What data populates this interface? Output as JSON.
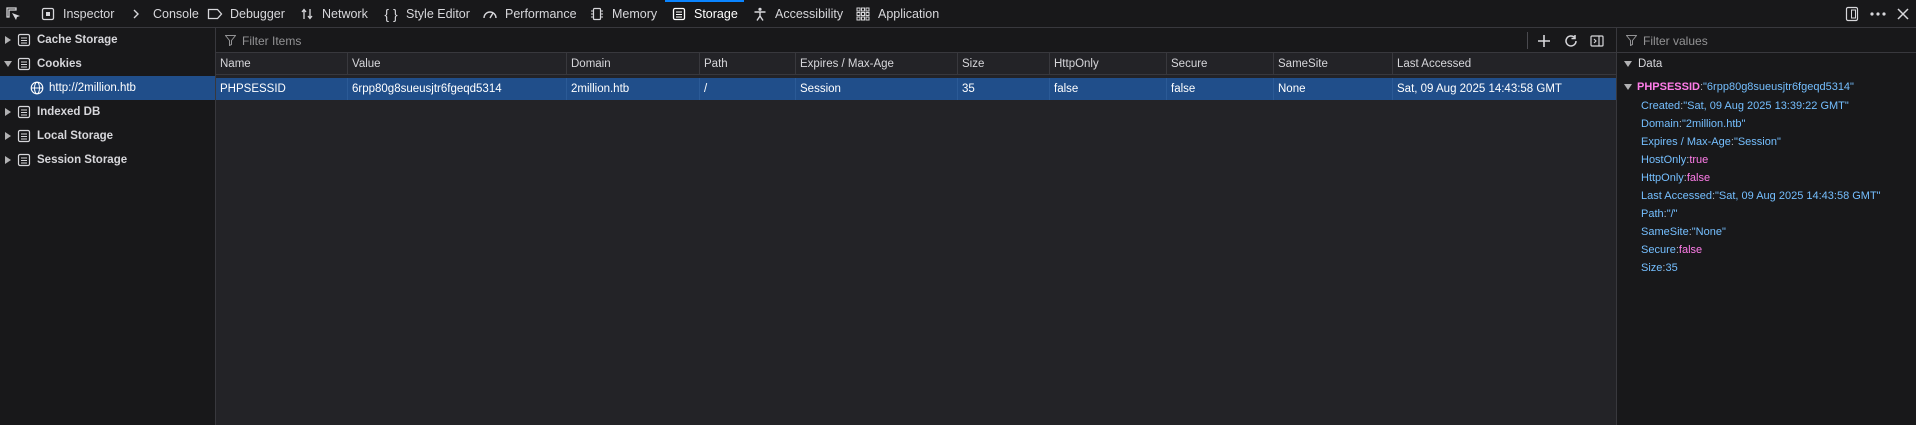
{
  "toolbar": {
    "tabs": [
      {
        "label": "Inspector",
        "icon": "inspector-icon"
      },
      {
        "label": "Console",
        "icon": "console-icon"
      },
      {
        "label": "Debugger",
        "icon": "debugger-icon"
      },
      {
        "label": "Network",
        "icon": "network-icon"
      },
      {
        "label": "Style Editor",
        "icon": "style-editor-icon"
      },
      {
        "label": "Performance",
        "icon": "performance-icon"
      },
      {
        "label": "Memory",
        "icon": "memory-icon"
      },
      {
        "label": "Storage",
        "icon": "storage-icon",
        "active": true
      },
      {
        "label": "Accessibility",
        "icon": "accessibility-icon"
      },
      {
        "label": "Application",
        "icon": "application-icon"
      }
    ]
  },
  "tree": {
    "items": [
      {
        "label": "Cache Storage",
        "expanded": false
      },
      {
        "label": "Cookies",
        "expanded": true
      },
      {
        "label": "http://2million.htb",
        "selected": true
      },
      {
        "label": "Indexed DB",
        "expanded": false
      },
      {
        "label": "Local Storage",
        "expanded": false
      },
      {
        "label": "Session Storage",
        "expanded": false
      }
    ]
  },
  "table": {
    "filter_placeholder": "Filter Items",
    "columns": [
      "Name",
      "Value",
      "Domain",
      "Path",
      "Expires / Max-Age",
      "Size",
      "HttpOnly",
      "Secure",
      "SameSite",
      "Last Accessed"
    ],
    "rows": [
      [
        "PHPSESSID",
        "6rpp80g8sueusjtr6fgeqd5314",
        "2million.htb",
        "/",
        "Session",
        "35",
        "false",
        "false",
        "None",
        "Sat, 09 Aug 2025 14:43:58 GMT"
      ]
    ]
  },
  "sidebar": {
    "filter_placeholder": "Filter values",
    "section": "Data",
    "root_key": "PHPSESSID",
    "root_value": "\"6rpp80g8sueusjtr6fgeqd5314\"",
    "props": [
      {
        "key": "Created",
        "value": "\"Sat, 09 Aug 2025 13:39:22 GMT\"",
        "kind": "s"
      },
      {
        "key": "Domain",
        "value": "\"2million.htb\"",
        "kind": "s"
      },
      {
        "key": "Expires / Max-Age",
        "value": "\"Session\"",
        "kind": "s"
      },
      {
        "key": "HostOnly",
        "value": "true",
        "kind": "b"
      },
      {
        "key": "HttpOnly",
        "value": "false",
        "kind": "b"
      },
      {
        "key": "Last Accessed",
        "value": "\"Sat, 09 Aug 2025 14:43:58 GMT\"",
        "kind": "s"
      },
      {
        "key": "Path",
        "value": "\"/\"",
        "kind": "s"
      },
      {
        "key": "SameSite",
        "value": "\"None\"",
        "kind": "s"
      },
      {
        "key": "Secure",
        "value": "false",
        "kind": "b"
      },
      {
        "key": "Size",
        "value": "35",
        "kind": "n"
      }
    ]
  },
  "colors": {
    "accent": "#0a84ff",
    "selection": "#204e8a",
    "key": "#75bfff",
    "bool": "#ff7de9"
  }
}
